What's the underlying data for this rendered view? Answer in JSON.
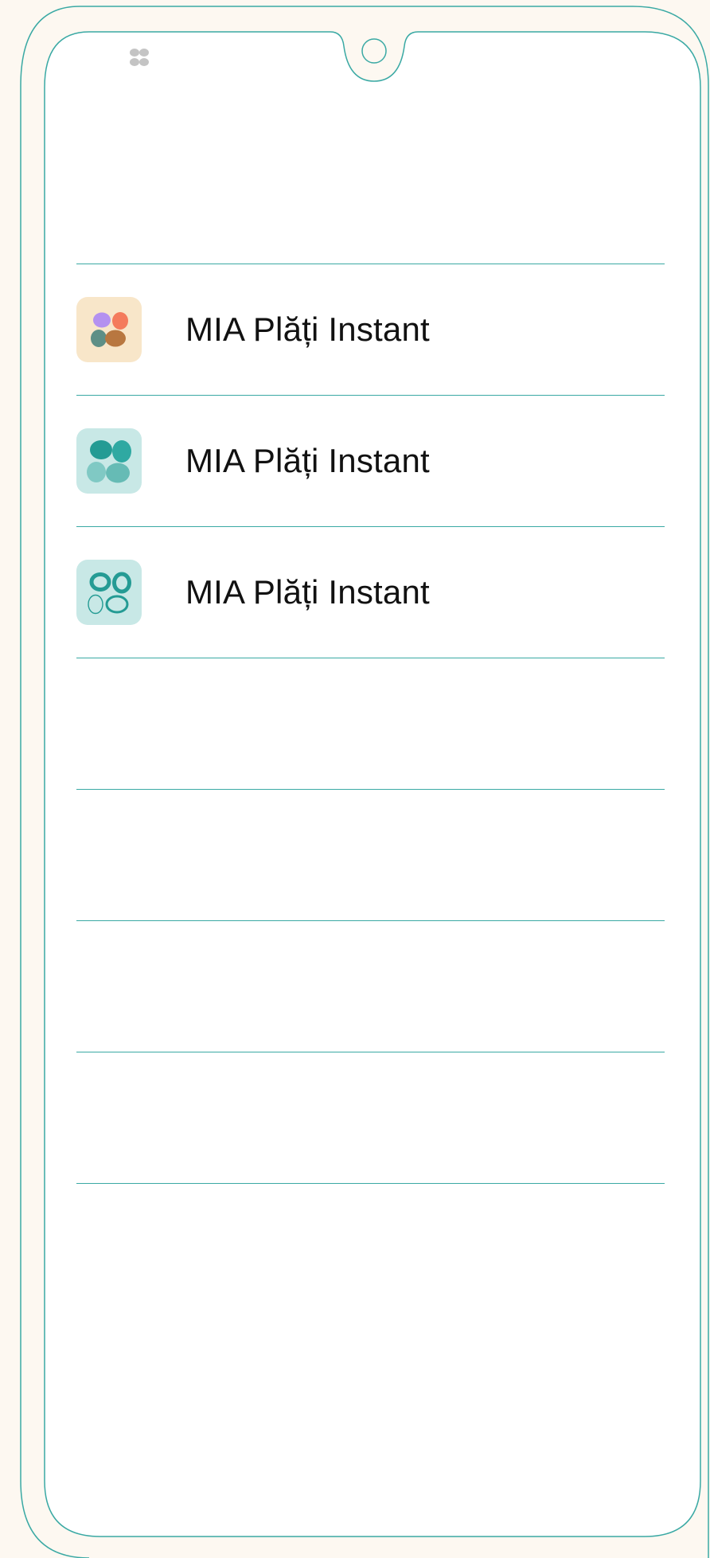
{
  "status_bar": {
    "icon": "app-grid-icon",
    "icon_color": "#c4c4c4"
  },
  "colors": {
    "background": "#fdf8f1",
    "screen": "#ffffff",
    "accent": "#3aa9a4",
    "text": "#111111"
  },
  "list": {
    "items": [
      {
        "label": "MIA Plăți Instant",
        "icon": "mia-logo-color-icon",
        "icon_bg": "#f8e6c9"
      },
      {
        "label": "MIA Plăți Instant",
        "icon": "mia-logo-teal-filled-icon",
        "icon_bg": "#c8e8e6"
      },
      {
        "label": "MIA Plăți Instant",
        "icon": "mia-logo-teal-outline-icon",
        "icon_bg": "#c8e8e6"
      }
    ],
    "empty_rows": 4
  }
}
